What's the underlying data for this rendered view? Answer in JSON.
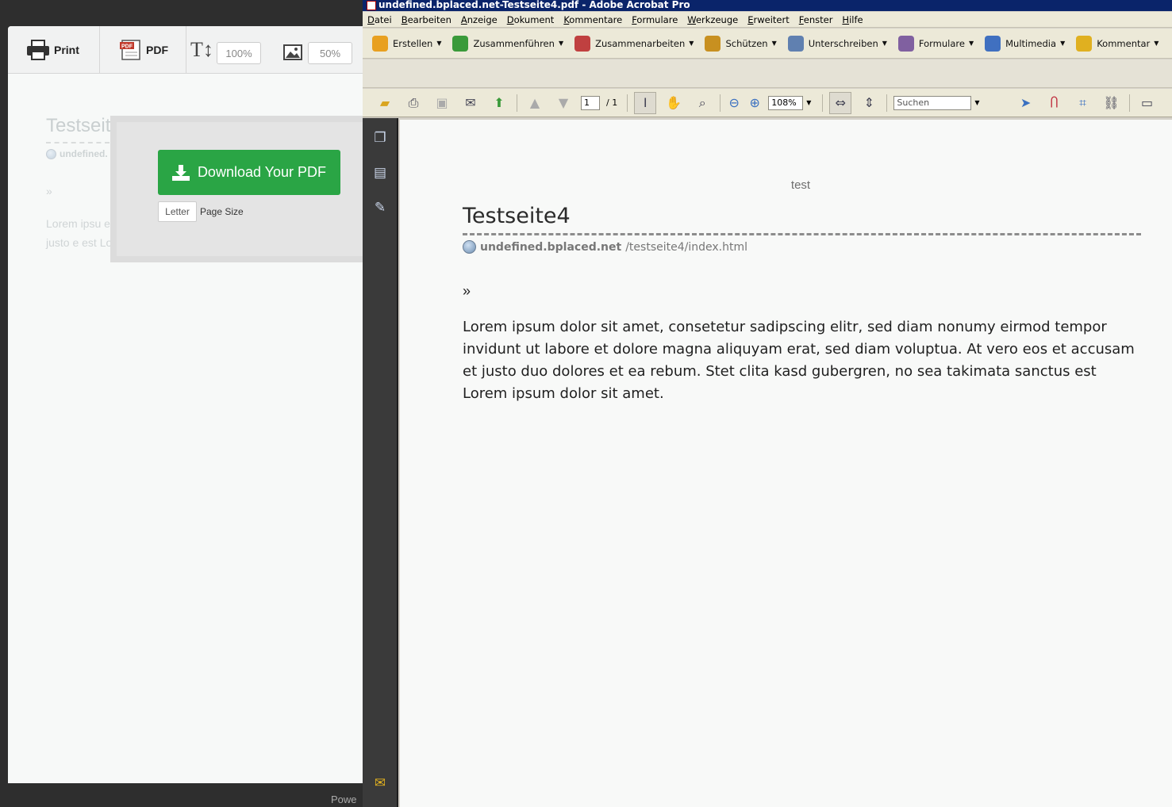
{
  "printfriendly": {
    "toolbar": {
      "print_label": "Print",
      "pdf_label": "PDF",
      "text_size": "100%",
      "image_size": "50%"
    },
    "content": {
      "title": "Testseit",
      "url": "undefined.",
      "raquo": "»",
      "body": "Lorem ipsu erat, sed diam voluptua. At vero eos et accusam et justo e est Lorem ipsum dolor sit amet."
    },
    "dialog": {
      "download_label": "Download Your PDF",
      "page_size_value": "Letter",
      "page_size_label": "Page Size"
    },
    "footer_text": "Powe"
  },
  "acrobat": {
    "window_title": "undefined.bplaced.net-Testseite4.pdf - Adobe Acrobat Pro",
    "menu": [
      "Datei",
      "Bearbeiten",
      "Anzeige",
      "Dokument",
      "Kommentare",
      "Formulare",
      "Werkzeuge",
      "Erweitert",
      "Fenster",
      "Hilfe"
    ],
    "tasks": [
      {
        "label": "Erstellen",
        "icon": "create-icon",
        "color": "#e8a020"
      },
      {
        "label": "Zusammenführen",
        "icon": "combine-icon",
        "color": "#3a9a3a"
      },
      {
        "label": "Zusammenarbeiten",
        "icon": "collaborate-icon",
        "color": "#c04040"
      },
      {
        "label": "Schützen",
        "icon": "lock-icon",
        "color": "#c89020"
      },
      {
        "label": "Unterschreiben",
        "icon": "pen-icon",
        "color": "#6080b0"
      },
      {
        "label": "Formulare",
        "icon": "forms-icon",
        "color": "#8060a0"
      },
      {
        "label": "Multimedia",
        "icon": "multimedia-icon",
        "color": "#4070c0"
      },
      {
        "label": "Kommentar",
        "icon": "comment-icon",
        "color": "#e0b020"
      }
    ],
    "nav": {
      "page_current": "1",
      "page_total": "/ 1",
      "zoom": "108%",
      "search_placeholder": "Suchen"
    },
    "document": {
      "header": "test",
      "title": "Testseite4",
      "url_domain": "undefined.bplaced.net",
      "url_path": "/testseite4/index.html",
      "raquo": "»",
      "body": "Lorem ipsum dolor sit amet, consetetur sadipscing elitr, sed diam nonumy eirmod tempor invidunt ut labore et dolore magna aliquyam erat, sed diam voluptua. At vero eos et accusam et justo duo dolores et ea rebum. Stet clita kasd gubergren, no sea takimata sanctus est Lorem ipsum dolor sit amet."
    }
  }
}
